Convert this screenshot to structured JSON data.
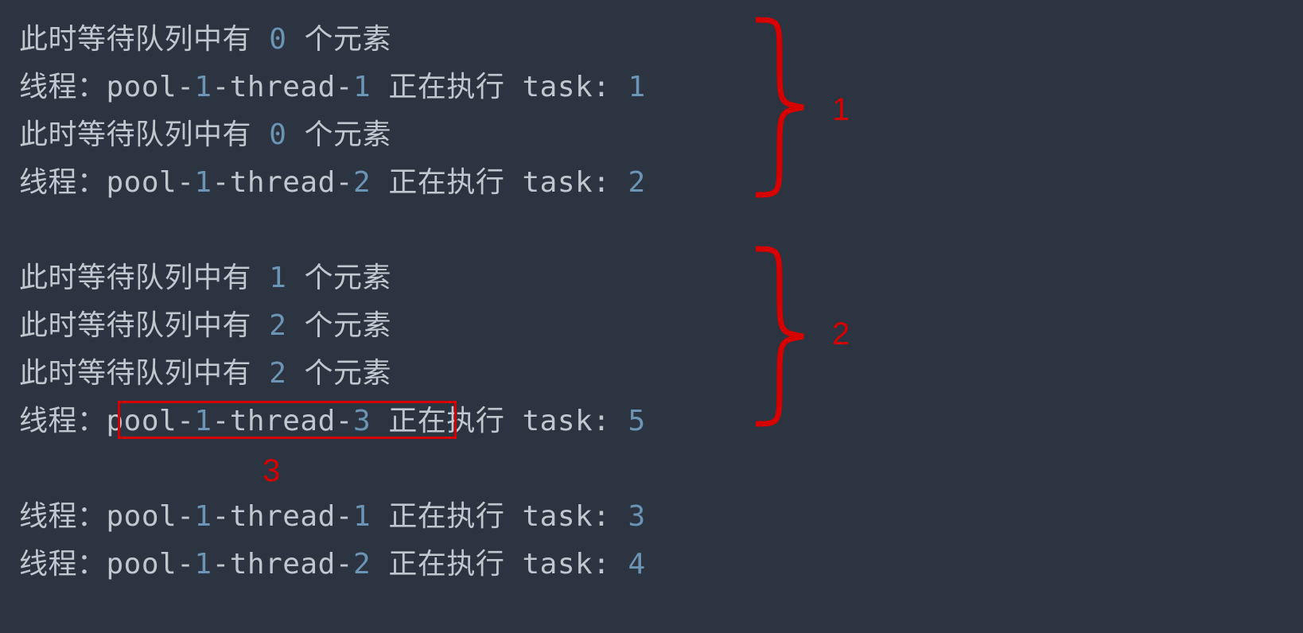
{
  "colors": {
    "bg": "#2b3440",
    "text": "#bfc7cf",
    "num": "#6c95b5",
    "anno": "#d60000"
  },
  "annotations": {
    "brace1": "1",
    "brace2": "2",
    "box": "3"
  },
  "lines": [
    {
      "t1": "此时等待队列中有 ",
      "n1": "0",
      "t2": " 个元素"
    },
    {
      "t1": "线程：pool-",
      "n1": "1",
      "t2": "-thread-",
      "n2": "1",
      "t3": " 正在执行 task: ",
      "n3": "1"
    },
    {
      "t1": "此时等待队列中有 ",
      "n1": "0",
      "t2": " 个元素"
    },
    {
      "t1": "线程：pool-",
      "n1": "1",
      "t2": "-thread-",
      "n2": "2",
      "t3": " 正在执行 task: ",
      "n3": "2"
    },
    null,
    {
      "t1": "此时等待队列中有 ",
      "n1": "1",
      "t2": " 个元素"
    },
    {
      "t1": "此时等待队列中有 ",
      "n1": "2",
      "t2": " 个元素"
    },
    {
      "t1": "此时等待队列中有 ",
      "n1": "2",
      "t2": " 个元素"
    },
    {
      "t1": "线程：pool-",
      "n1": "1",
      "t2": "-thread-",
      "n2": "3",
      "t3": " 正在执行 task: ",
      "n3": "5"
    },
    null,
    {
      "t1": "线程：pool-",
      "n1": "1",
      "t2": "-thread-",
      "n2": "1",
      "t3": " 正在执行 task: ",
      "n3": "3"
    },
    {
      "t1": "线程：pool-",
      "n1": "1",
      "t2": "-thread-",
      "n2": "2",
      "t3": " 正在执行 task: ",
      "n3": "4"
    }
  ]
}
